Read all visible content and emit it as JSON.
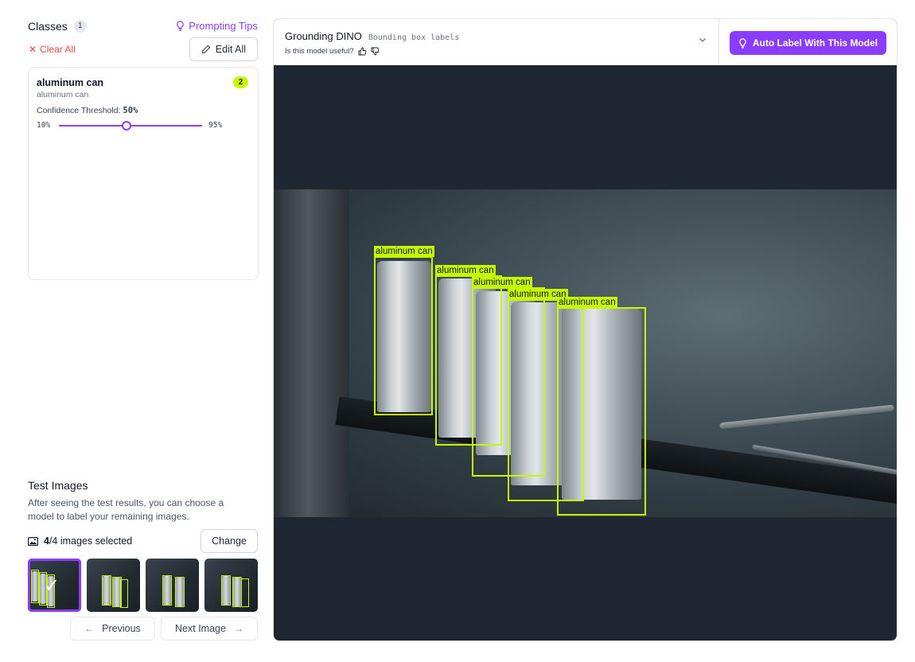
{
  "classes_panel": {
    "title": "Classes",
    "count": "1",
    "prompting_tips": "Prompting Tips",
    "clear_all": "Clear All",
    "edit_all": "Edit All",
    "class": {
      "name": "aluminum can",
      "prompt": "aluminum can",
      "detections": "2",
      "confidence_label": "Confidence Threshold:",
      "confidence_value": "50%",
      "slider_min": "10%",
      "slider_max": "95%",
      "threshold_fraction": 0.47
    }
  },
  "test_images": {
    "title": "Test Images",
    "description": "After seeing the test results, you can choose a model to label your remaining images.",
    "selected_count": "4",
    "selected_suffix": "/4 images selected",
    "change": "Change",
    "previous": "Previous",
    "next": "Next Image"
  },
  "model_bar": {
    "model_name": "Grounding DINO",
    "model_type": "Bounding box labels",
    "useful_question": "Is this model useful?",
    "auto_label": "Auto Label With This Model"
  },
  "detections": [
    {
      "label": "aluminum can"
    },
    {
      "label": "aluminum can"
    },
    {
      "label": "aluminum can"
    },
    {
      "label": "aluminum can"
    },
    {
      "label": "aluminum can"
    }
  ],
  "colors": {
    "accent": "#8b3dff",
    "box": "#c6f800",
    "clear": "#ef4444"
  },
  "icons": [
    "lightbulb-icon",
    "close-icon",
    "pencil-icon",
    "thumbs-up-icon",
    "thumbs-down-icon",
    "chevron-down-icon",
    "image-icon",
    "arrow-left-icon",
    "arrow-right-icon",
    "checkmark-icon"
  ]
}
